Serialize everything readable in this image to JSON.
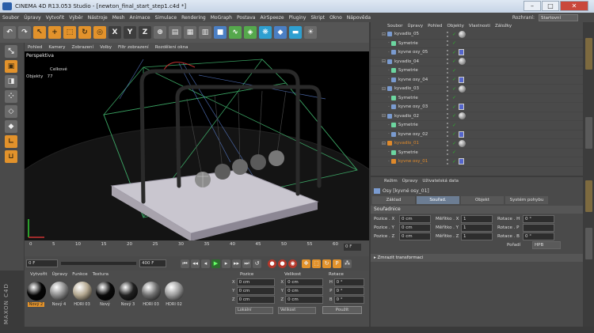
{
  "window": {
    "title": "CINEMA 4D R13.053 Studio - [newton_final_start_step1.c4d *]"
  },
  "menubar": {
    "items": [
      "Soubor",
      "Úpravy",
      "Vytvořit",
      "Výběr",
      "Nástroje",
      "Mesh",
      "Animace",
      "Simulace",
      "Rendering",
      "MoGraph",
      "Postava",
      "AirSpeeze",
      "Pluginy",
      "Skript",
      "Okno",
      "Nápověda"
    ],
    "layout_label": "Rozhraní:",
    "layout_value": "Startovní"
  },
  "viewport": {
    "menu": [
      "Pohled",
      "Kamery",
      "Zobrazení",
      "Volby",
      "Filtr zobrazení",
      "Rozdělení okna"
    ],
    "label": "Perspektiva",
    "stats_label": "Celkové",
    "objects_label": "Objekty",
    "objects_count": "77"
  },
  "timeline": {
    "ticks": [
      "0",
      "5",
      "10",
      "15",
      "20",
      "25",
      "30",
      "35",
      "40",
      "45",
      "50",
      "55",
      "60"
    ],
    "frame_end": "0 F"
  },
  "transport": {
    "current_frame": "0 F",
    "end_frame": "400 F"
  },
  "materials": {
    "menu": [
      "Vytvořit",
      "Úpravy",
      "Funkce",
      "Textura"
    ],
    "items": [
      {
        "name": "Nový 2",
        "color": "#050505",
        "selected": true
      },
      {
        "name": "Nový 4",
        "color": "#8a8a8a",
        "selected": false
      },
      {
        "name": "HDRI 03",
        "color": "#b2a68e",
        "selected": false
      },
      {
        "name": "Nový",
        "color": "#0a0a0a",
        "selected": false
      },
      {
        "name": "Nový 3",
        "color": "#202020",
        "selected": false
      },
      {
        "name": "HDRI 03",
        "color": "#6e6e6e",
        "selected": false
      },
      {
        "name": "HDRI 02",
        "color": "#9a9a9a",
        "selected": false
      }
    ]
  },
  "coords": {
    "headers": [
      "Pozice",
      "Velikost",
      "Rotace"
    ],
    "rows": [
      {
        "axis": "X",
        "pos": "0 cm",
        "size": "0 cm",
        "rot_axis": "H",
        "rot": "0 °"
      },
      {
        "axis": "Y",
        "pos": "0 cm",
        "size": "0 cm",
        "rot_axis": "P",
        "rot": "0 °"
      },
      {
        "axis": "Z",
        "pos": "0 cm",
        "size": "0 cm",
        "rot_axis": "B",
        "rot": "0 °"
      }
    ],
    "mode": "Lokální",
    "size_mode": "Velikost",
    "apply": "Použít"
  },
  "objects": {
    "menu": [
      "Soubor",
      "Úpravy",
      "Pohled",
      "Objekty",
      "Vlastnosti",
      "Záložky"
    ],
    "rows": [
      {
        "name": "kyvadlo_05",
        "indent": 1,
        "icon": "#7a9bd0",
        "hl": false,
        "tag": "sphere"
      },
      {
        "name": "Symetrie",
        "indent": 2,
        "icon": "#6cd6a0",
        "hl": false,
        "tag": "none"
      },
      {
        "name": "kyvne osy_05",
        "indent": 2,
        "icon": "#7a9bd0",
        "hl": false,
        "tag": "box"
      },
      {
        "name": "kyvadlo_04",
        "indent": 1,
        "icon": "#7a9bd0",
        "hl": false,
        "tag": "sphere"
      },
      {
        "name": "Symetrie",
        "indent": 2,
        "icon": "#6cd6a0",
        "hl": false,
        "tag": "none"
      },
      {
        "name": "kyvne osy_04",
        "indent": 2,
        "icon": "#7a9bd0",
        "hl": false,
        "tag": "box"
      },
      {
        "name": "kyvadlo_03",
        "indent": 1,
        "icon": "#7a9bd0",
        "hl": false,
        "tag": "sphere"
      },
      {
        "name": "Symetrie",
        "indent": 2,
        "icon": "#6cd6a0",
        "hl": false,
        "tag": "none"
      },
      {
        "name": "kyvne osy_03",
        "indent": 2,
        "icon": "#7a9bd0",
        "hl": false,
        "tag": "box"
      },
      {
        "name": "kyvadlo_02",
        "indent": 1,
        "icon": "#7a9bd0",
        "hl": false,
        "tag": "sphere"
      },
      {
        "name": "Symetrie",
        "indent": 2,
        "icon": "#6cd6a0",
        "hl": false,
        "tag": "none"
      },
      {
        "name": "kyvne osy_02",
        "indent": 2,
        "icon": "#7a9bd0",
        "hl": false,
        "tag": "box"
      },
      {
        "name": "kyvadlo_01",
        "indent": 1,
        "icon": "#e08a2b",
        "hl": true,
        "tag": "sphere"
      },
      {
        "name": "Symetrie",
        "indent": 2,
        "icon": "#6cd6a0",
        "hl": false,
        "tag": "none"
      },
      {
        "name": "kyvne osy_01",
        "indent": 2,
        "icon": "#e08a2b",
        "hl": true,
        "tag": "box"
      }
    ]
  },
  "attributes": {
    "menu": [
      "Režim",
      "Úpravy",
      "Uživatelská data"
    ],
    "title": "Osy [kyvné osy_01]",
    "tabs": [
      "Základ",
      "Souřad.",
      "Objekt",
      "Systém pohybu"
    ],
    "active_tab": "Souřad.",
    "section": "Souřadnice",
    "rows": [
      {
        "p_label": "Pozice . X",
        "p": "0 cm",
        "s_label": "Měřítko . X",
        "s": "1",
        "r_label": "Rotace . H",
        "r": "0 °"
      },
      {
        "p_label": "Pozice . Y",
        "p": "0 cm",
        "s_label": "Měřítko . Y",
        "s": "1",
        "r_label": "Rotace . P",
        "r": ""
      },
      {
        "p_label": "Pozice . Z",
        "p": "0 cm",
        "s_label": "Měřítko . Z",
        "s": "1",
        "r_label": "Rotace . B",
        "r": "0 °"
      }
    ],
    "order_label": "Pořadí",
    "order_value": "HPB",
    "frozen_section": "Zmrazit transformaci"
  }
}
